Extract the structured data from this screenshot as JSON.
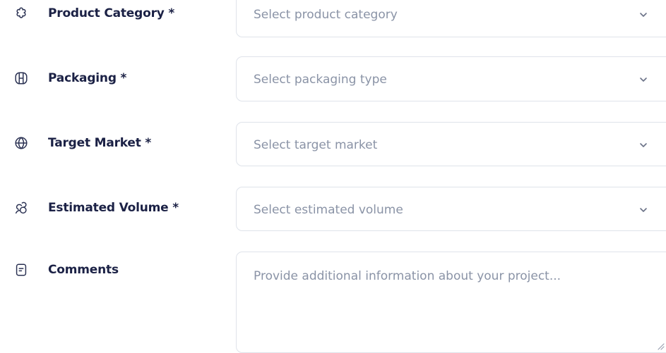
{
  "form": {
    "fields": [
      {
        "label": "Product Category *",
        "icon": "flower-icon",
        "placeholder": "Select product category"
      },
      {
        "label": "Packaging *",
        "icon": "package-icon",
        "placeholder": "Select packaging type"
      },
      {
        "label": "Target Market *",
        "icon": "globe-icon",
        "placeholder": "Select target market"
      },
      {
        "label": "Estimated Volume *",
        "icon": "chart-icon",
        "placeholder": "Select estimated volume"
      }
    ],
    "comments": {
      "label": "Comments",
      "icon": "document-icon",
      "placeholder": "Provide additional information about your project..."
    }
  },
  "colors": {
    "label": "#1b2145",
    "placeholder": "#8a93a6",
    "border": "#dfe3ea",
    "icon": "#2a3152"
  }
}
